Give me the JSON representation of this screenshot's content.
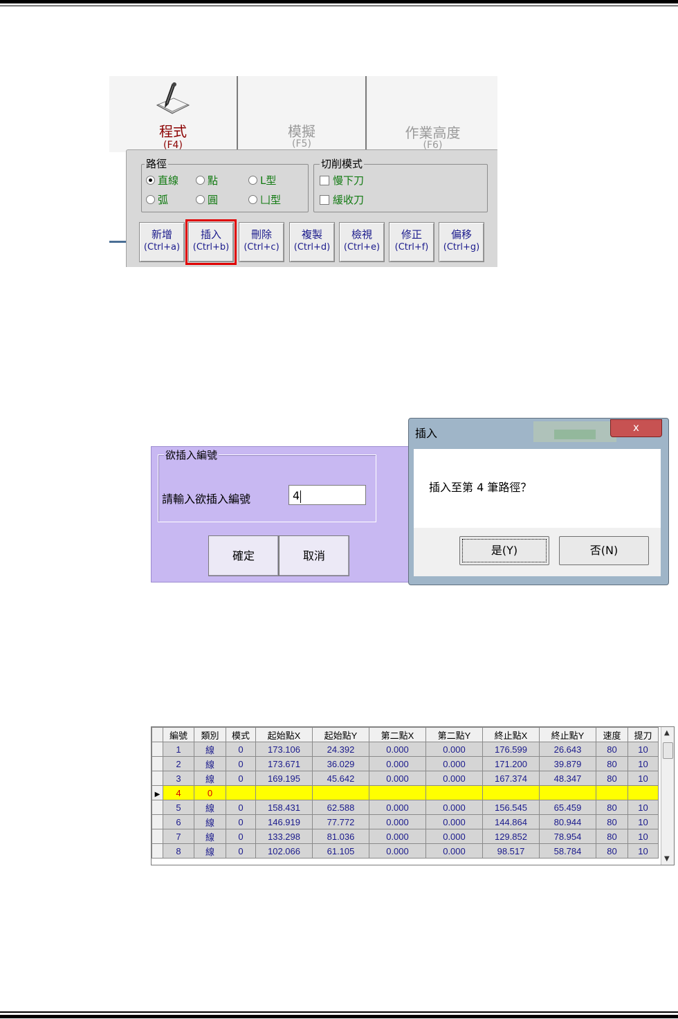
{
  "toolbar": {
    "tabs": [
      {
        "label": "程式",
        "key": "(F4)"
      },
      {
        "label": "模擬",
        "key": "(F5)"
      },
      {
        "label": "作業高度",
        "key": "(F6)"
      }
    ],
    "path_group": {
      "legend": "路徑",
      "options": [
        "直線",
        "點",
        "L型",
        "弧",
        "圓",
        "凵型"
      ],
      "selected": "直線"
    },
    "cut_group": {
      "legend": "切削模式",
      "options": [
        "慢下刀",
        "緩收刀"
      ]
    },
    "buttons": [
      {
        "label": "新增",
        "key": "(Ctrl+a)"
      },
      {
        "label": "插入",
        "key": "(Ctrl+b)"
      },
      {
        "label": "刪除",
        "key": "(Ctrl+c)"
      },
      {
        "label": "複製",
        "key": "(Ctrl+d)"
      },
      {
        "label": "檢視",
        "key": "(Ctrl+e)"
      },
      {
        "label": "修正",
        "key": "(Ctrl+f)"
      },
      {
        "label": "偏移",
        "key": "(Ctrl+g)"
      }
    ],
    "highlighted_button": "插入"
  },
  "insert_dialog": {
    "group_title": "欲插入編號",
    "prompt": "請輸入欲插入編號",
    "value": "4",
    "ok": "確定",
    "cancel": "取消",
    "background": "#c8b8f2"
  },
  "confirm_dialog": {
    "title": "插入",
    "close": "x",
    "message": "插入至第 4 筆路徑？",
    "yes": "是(Y)",
    "no": "否(N)"
  },
  "grid": {
    "headers": [
      "編號",
      "類別",
      "模式",
      "起始點X",
      "起始點Y",
      "第二點X",
      "第二點Y",
      "終止點X",
      "終止點Y",
      "速度",
      "提刀"
    ],
    "rows": [
      [
        "1",
        "線",
        "0",
        "173.106",
        "24.392",
        "0.000",
        "0.000",
        "176.599",
        "26.643",
        "80",
        "10"
      ],
      [
        "2",
        "線",
        "0",
        "173.671",
        "36.029",
        "0.000",
        "0.000",
        "171.200",
        "39.879",
        "80",
        "10"
      ],
      [
        "3",
        "線",
        "0",
        "169.195",
        "45.642",
        "0.000",
        "0.000",
        "167.374",
        "48.347",
        "80",
        "10"
      ],
      [
        "4",
        "0",
        "",
        "",
        "",
        "",
        "",
        "",
        "",
        "",
        ""
      ],
      [
        "5",
        "線",
        "0",
        "158.431",
        "62.588",
        "0.000",
        "0.000",
        "156.545",
        "65.459",
        "80",
        "10"
      ],
      [
        "6",
        "線",
        "0",
        "146.919",
        "77.772",
        "0.000",
        "0.000",
        "144.864",
        "80.944",
        "80",
        "10"
      ],
      [
        "7",
        "線",
        "0",
        "133.298",
        "81.036",
        "0.000",
        "0.000",
        "129.852",
        "78.954",
        "80",
        "10"
      ],
      [
        "8",
        "線",
        "0",
        "102.066",
        "61.105",
        "0.000",
        "0.000",
        "98.517",
        "58.784",
        "80",
        "10"
      ]
    ],
    "selected_row_index": 3,
    "selected_color": "#ffff00"
  }
}
